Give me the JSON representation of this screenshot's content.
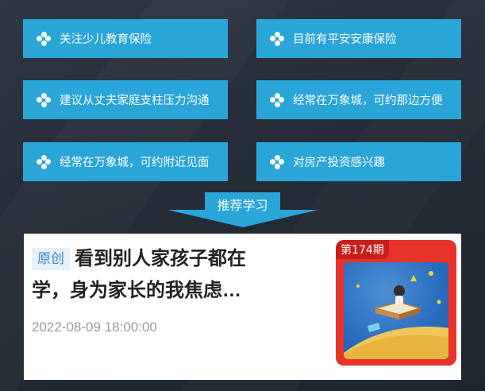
{
  "tags": [
    {
      "label": "关注少儿教育保险"
    },
    {
      "label": "目前有平安安康保险"
    },
    {
      "label": "建议从丈夫家庭支柱压力沟通"
    },
    {
      "label": "经常在万象城，可约那边方便"
    },
    {
      "label": "经常在万象城，可约附近见面"
    },
    {
      "label": "对房产投资感兴趣"
    }
  ],
  "section": {
    "title": "推荐学习"
  },
  "article": {
    "badge": "原创",
    "title": "看到别人家孩子都在学，身为家长的我焦虑…",
    "date": "2022-08-09 18:00:00",
    "issue": "第174期"
  },
  "colors": {
    "accent": "#2aa5d8",
    "badge_bg": "#e6f1fb",
    "badge_text": "#3a86c8",
    "thumb_frame": "#e8332b"
  },
  "icons": {
    "tag_icon": "four-dots-icon"
  }
}
